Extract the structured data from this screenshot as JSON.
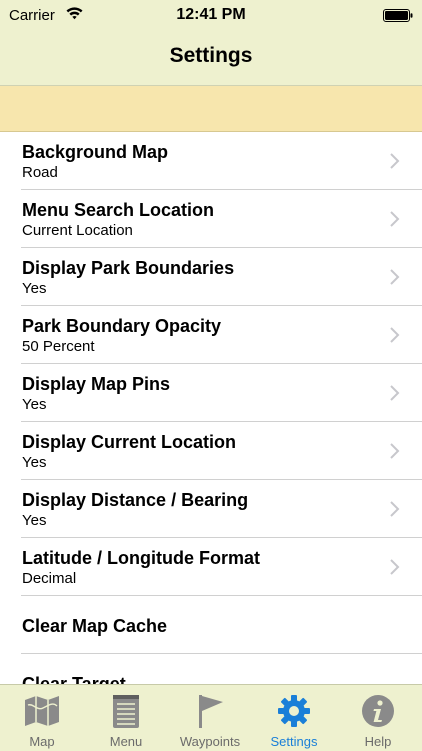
{
  "status_bar": {
    "carrier": "Carrier",
    "time": "12:41 PM"
  },
  "nav": {
    "title": "Settings"
  },
  "settings": [
    {
      "title": "Background Map",
      "value": "Road"
    },
    {
      "title": "Menu Search Location",
      "value": "Current Location"
    },
    {
      "title": "Display Park Boundaries",
      "value": "Yes"
    },
    {
      "title": "Park Boundary Opacity",
      "value": "50 Percent"
    },
    {
      "title": "Display Map Pins",
      "value": "Yes"
    },
    {
      "title": "Display Current Location",
      "value": "Yes"
    },
    {
      "title": "Display Distance / Bearing",
      "value": "Yes"
    },
    {
      "title": "Latitude / Longitude Format",
      "value": "Decimal"
    }
  ],
  "actions": [
    {
      "title": "Clear Map Cache"
    },
    {
      "title": "Clear Target"
    }
  ],
  "tabs": [
    {
      "label": "Map",
      "icon": "map-icon"
    },
    {
      "label": "Menu",
      "icon": "menu-icon"
    },
    {
      "label": "Waypoints",
      "icon": "flag-icon"
    },
    {
      "label": "Settings",
      "icon": "gear-icon",
      "active": true
    },
    {
      "label": "Help",
      "icon": "info-icon"
    }
  ],
  "colors": {
    "bar_background": "#eef1cf",
    "banner_background": "#f7e6ad",
    "active_tab": "#1a7fd8",
    "inactive_tab": "#6b6b6b"
  }
}
